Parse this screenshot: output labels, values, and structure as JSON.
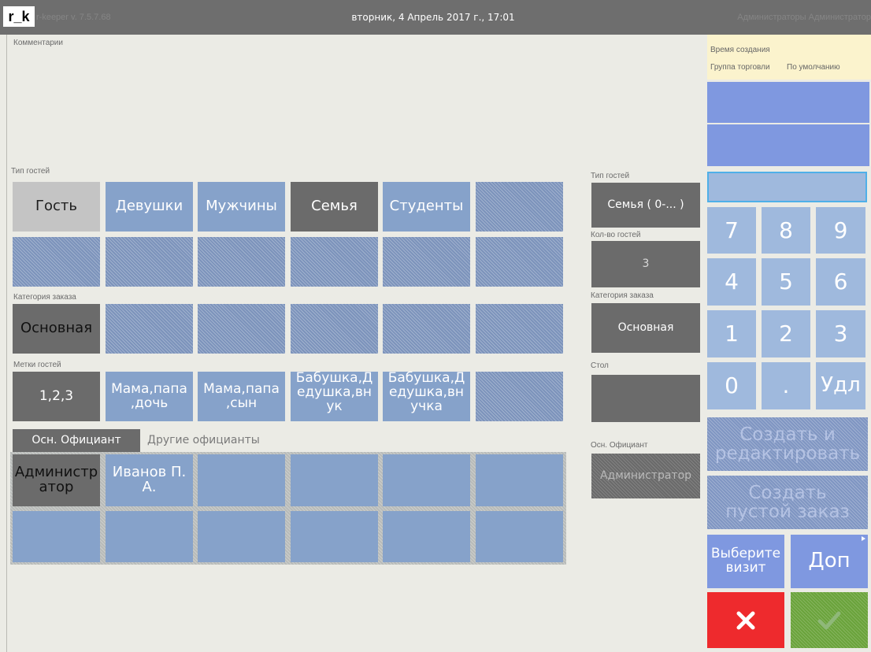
{
  "header": {
    "logo": "r_k",
    "app_version": "r-keeper v. 7.5.7.68",
    "datetime": "вторник, 4 Апрель 2017 г., 17:01",
    "user": "Администраторы Администратор"
  },
  "comments": {
    "label": "Комментарии"
  },
  "guest_type": {
    "label": "Тип гостей",
    "buttons": [
      "Гость",
      "Девушки",
      "Мужчины",
      "Семья",
      "Студенты"
    ]
  },
  "order_category": {
    "label": "Категория заказа",
    "selected": "Основная"
  },
  "guest_marks": {
    "label": "Метки гостей",
    "buttons": [
      "1,2,3",
      "Мама,папа ,дочь",
      "Мама,папа ,сын",
      "Бабушка,Д едушка,вн ук",
      "Бабушка,Д едушка,вн учка"
    ]
  },
  "waiter_tabs": {
    "main": "Осн. Официант",
    "other": "Другие официанты"
  },
  "waiters": [
    "Администр атор",
    "Иванов П. А."
  ],
  "summary": {
    "guest_type_label": "Тип гостей",
    "guest_type_value": "Семья ( 0-... )",
    "guests_count_label": "Кол-во гостей",
    "guests_count_value": "3",
    "order_category_label": "Категория заказа",
    "order_category_value": "Основная",
    "table_label": "Стол",
    "table_value": "",
    "main_waiter_label": "Осн. Официант",
    "main_waiter_value": "Администратор"
  },
  "info_panel": {
    "created_label": "Время создания",
    "trade_group_label": "Группа торговли",
    "trade_group_value": "По умолчанию"
  },
  "keypad": {
    "input_value": "",
    "keys": [
      "7",
      "8",
      "9",
      "4",
      "5",
      "6",
      "1",
      "2",
      "3",
      "0",
      ".",
      "Удл"
    ]
  },
  "actions": {
    "create_edit": "Создать и редактировать",
    "create_empty": "Создать пустой заказ",
    "choose_visit": "Выберите визит",
    "more": "Доп",
    "cancel_icon": "close-icon",
    "ok_icon": "check-icon"
  },
  "colors": {
    "background": "#ebebe5",
    "header": "#6e6e6e",
    "blue_button": "#86a2ca",
    "dark_button": "#6b6b6b",
    "keypad": "#9fb9dd",
    "cancel": "#ee2a2d",
    "ok": "#6aa33b",
    "info_panel": "#fbf3cd"
  }
}
